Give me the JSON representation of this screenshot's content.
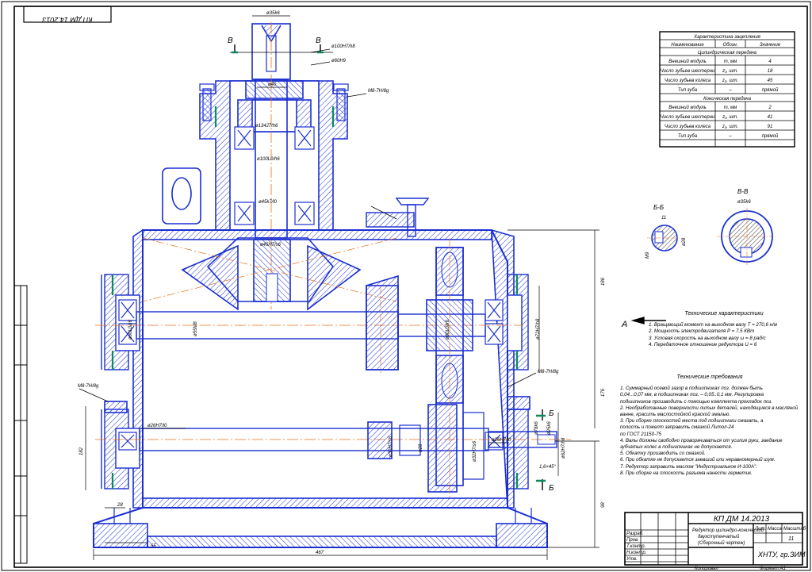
{
  "drawing": {
    "code": "КП ДМ 14.2013",
    "code_rotated": "КП ДМ 14.2013",
    "title_lines": [
      "Редуктор цилиндро-конический",
      "двухступенчатый",
      "(Сборочный чертеж)"
    ],
    "org": "ХНТУ, гр.ЗИМ",
    "sheets": "11"
  },
  "spec_table": {
    "title": "Характеристика зацепления",
    "headers": [
      "Наименование",
      "Обозн.",
      "Значение"
    ],
    "sections": [
      {
        "name": "Цилиндрическая передача",
        "rows": [
          [
            "Внешний модуль",
            "m, мм",
            "4"
          ],
          [
            "Число зубьев шестерни",
            "z₁, шт.",
            "18"
          ],
          [
            "Число зубьев колеса",
            "z₂, шт.",
            "45"
          ],
          [
            "Тип зуба",
            "–",
            "прямой"
          ]
        ]
      },
      {
        "name": "Коническая передача",
        "rows": [
          [
            "Внешний модуль",
            "m, мм",
            "2"
          ],
          [
            "Число зубьев шестерни",
            "z₁, шт.",
            "41"
          ],
          [
            "Число зубьев колеса",
            "z₂, шт.",
            "91"
          ],
          [
            "Тип зуба",
            "–",
            "прямой"
          ]
        ]
      }
    ]
  },
  "tech_characteristics": {
    "title": "Технические характеристики",
    "items": [
      "1. Вращающий момент на выходном валу  T = 270,6 н/м",
      "2. Мощность электродвигателя  P = 7,5 КВт",
      "3. Угловая скорость на выходном валу  ω = 8 рад/с",
      "4. Передаточное отношение редуктора  U = 6"
    ]
  },
  "tech_requirements": {
    "title": "Технические требования",
    "lines": [
      "1. Суммарный осевой зазор в подшипниках поз.  должен быть",
      "0,04...0,07 мм, в подшипниках поз.  – 0,05..0,1 мм. Регулировка",
      "подшипников производить с помощью комплекта прокладок поз.",
      "2. Необработанные поверхности литых деталей, находящиеся в масляной",
      "ванне, красить маслостойкой краской эмалью.",
      "3. При сборке плоскостей места под подшипники смазать, а",
      "полость и пожелт заправить смазкой Литол-24",
      "по ГОСТ 21150-75",
      "4. Валы должны свободно проворачиваться от усилия руки, заедание",
      "зубчатых колес в подшипниках не допускается.",
      "5. Обкатку производить со смазкой.",
      "6. При обкатке не допускается заевший или неравномерный шум.",
      "7. Редуктор заправить маслом \"Индустриальное И-100А\".",
      "8. При сборке на плоскость разъема нанести герметик."
    ]
  },
  "section_labels": {
    "b": "Б-Б",
    "v": "В-В",
    "B": "Б",
    "V": "В",
    "A": "А"
  },
  "fits": {
    "shaft_top": "ø35k6",
    "housing_top": "ø100H7/h8",
    "sleeve": "ø60H9",
    "bore_40": "ø40",
    "thread": "M8-7H/8g",
    "fit_m34": "ø134J7/h6",
    "fit_100": "ø100L0/h6",
    "fit_45": "ø45k7/l0",
    "fit_45b": "ø45H7/s6",
    "fit_55": "ø55M8",
    "fit_60": "ø60L0/k6",
    "fit_72": "ø72H7/h8",
    "fit_26": "ø26H7/l0",
    "fit_26b": "ø26H7/l0",
    "fit_30": "ø30H7/s6",
    "fit_28": "ø28",
    "fit_78": "ø78k6",
    "fit_32": "ø32H7/s6",
    "fit_25": "ø25k6",
    "fit_62": "ø62H7/h8",
    "fit_35b": "ø35k6",
    "m8_right": "M8-7H/8g",
    "m8_left": "M8-7H/8g",
    "chamfer": "1,6×45°"
  },
  "dims": {
    "overall_length": "467",
    "height_upper": "186",
    "height_mid": "176",
    "height_lower": "98",
    "left_vert": "182",
    "base_offset": "28",
    "foot": "55",
    "sect_b_11": "11",
    "sect_b_28": "ø28",
    "sect_b_m9": "М9"
  },
  "stamp": {
    "roles": [
      "Разраб.",
      "Пров.",
      "Т.контр.",
      "Н.контр.",
      "Утв."
    ],
    "col_heads": [
      "Лит.",
      "Масса",
      "Масштаб"
    ],
    "footer_left": "Копировал",
    "footer_right": "Формат   A1"
  },
  "colors": {
    "line": "#1a2fd0",
    "hatch": "#1a2fd0",
    "center": "#e8741a",
    "seal": "#0a8a5a",
    "text": "#000000"
  }
}
